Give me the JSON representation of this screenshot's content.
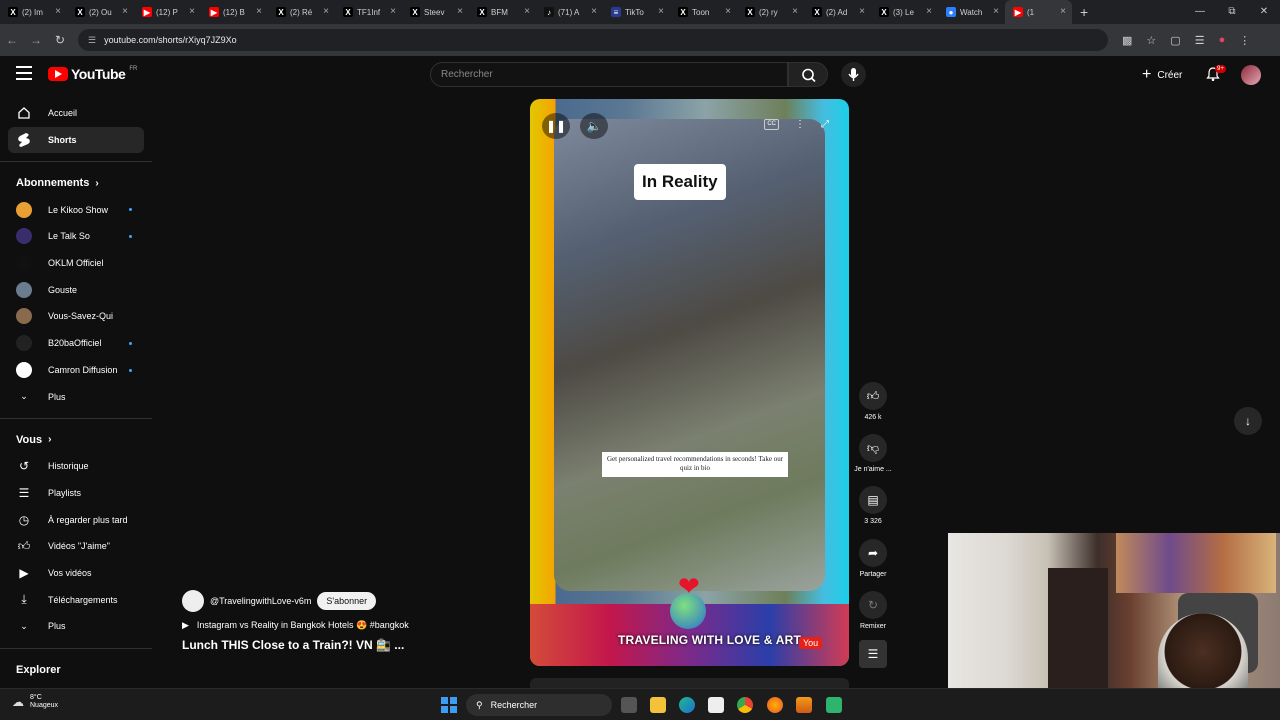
{
  "browser": {
    "tabs": [
      {
        "label": "(2) Im",
        "icon": "x-icon"
      },
      {
        "label": "(2) Ou",
        "icon": "x-icon"
      },
      {
        "label": "(12) P",
        "icon": "youtube-icon"
      },
      {
        "label": "(12) B",
        "icon": "youtube-icon"
      },
      {
        "label": "(2) Ré",
        "icon": "x-icon"
      },
      {
        "label": "TF1Inf",
        "icon": "x-icon"
      },
      {
        "label": "Steev",
        "icon": "x-icon"
      },
      {
        "label": "BFM",
        "icon": "x-icon"
      },
      {
        "label": "(71) A",
        "icon": "tiktok-icon"
      },
      {
        "label": "TikTo",
        "icon": "news-icon"
      },
      {
        "label": "Toon",
        "icon": "x-icon"
      },
      {
        "label": "(2) ry",
        "icon": "x-icon"
      },
      {
        "label": "(2) Ad",
        "icon": "x-icon"
      },
      {
        "label": "(3) Le",
        "icon": "x-icon"
      },
      {
        "label": "Watch",
        "icon": "watch-icon"
      },
      {
        "label": "(1",
        "icon": "youtube-icon"
      }
    ],
    "url": "youtube.com/shorts/rXiyq7JZ9Xo"
  },
  "header": {
    "logo_text": "YouTube",
    "logo_region": "FR",
    "search_placeholder": "Rechercher",
    "create_label": "Créer",
    "notif_badge": "9+"
  },
  "sidebar": {
    "top": [
      {
        "label": "Accueil",
        "icon": "home-icon"
      },
      {
        "label": "Shorts",
        "icon": "shorts-icon"
      }
    ],
    "subs_title": "Abonnements",
    "subs": [
      {
        "label": "Le Kikoo Show",
        "color": "#e8a033",
        "dot": true
      },
      {
        "label": "Le Talk So",
        "color": "#3a2d6b",
        "dot": true
      },
      {
        "label": "OKLM Officiel",
        "color": "#111111",
        "dot": false
      },
      {
        "label": "Gouste",
        "color": "#6b7c8e",
        "dot": false
      },
      {
        "label": "Vous-Savez-Qui",
        "color": "#8a6a4d",
        "dot": false
      },
      {
        "label": "B20baOfficiel",
        "color": "#222222",
        "dot": true
      },
      {
        "label": "Camron Diffusion",
        "color": "#ffffff",
        "dot": true
      }
    ],
    "subs_more": "Plus",
    "you_title": "Vous",
    "you_items": [
      {
        "label": "Historique",
        "icon": "history-icon"
      },
      {
        "label": "Playlists",
        "icon": "playlist-icon"
      },
      {
        "label": "À regarder plus tard",
        "icon": "clock-icon"
      },
      {
        "label": "Vidéos \"J'aime\"",
        "icon": "like-icon"
      },
      {
        "label": "Vos vidéos",
        "icon": "video-icon"
      },
      {
        "label": "Téléchargements",
        "icon": "download-icon"
      }
    ],
    "you_more": "Plus",
    "explore_title": "Explorer"
  },
  "video": {
    "overlay_text": "In Reality",
    "caption": "Get personalized travel recommendations in seconds! Take our quiz in bio",
    "banner_text": "TRAVELING WITH LOVE & ART",
    "banner_logo": "You"
  },
  "actions": {
    "likes": "426 k",
    "dislike_label": "Je n'aime ...",
    "comments": "3 326",
    "share_label": "Partager",
    "remix_label": "Remixer"
  },
  "meta": {
    "channel": "@TravelingwithLove-v6m",
    "subscribe": "S'abonner",
    "video_link": "Instagram vs Reality in Bangkok Hotels 😍 #bangkok",
    "title": "Lunch THIS Close to a Train?! VN 🚉 ..."
  },
  "taskbar": {
    "temp": "8°C",
    "weather": "Nuageux",
    "search": "Rechercher"
  }
}
